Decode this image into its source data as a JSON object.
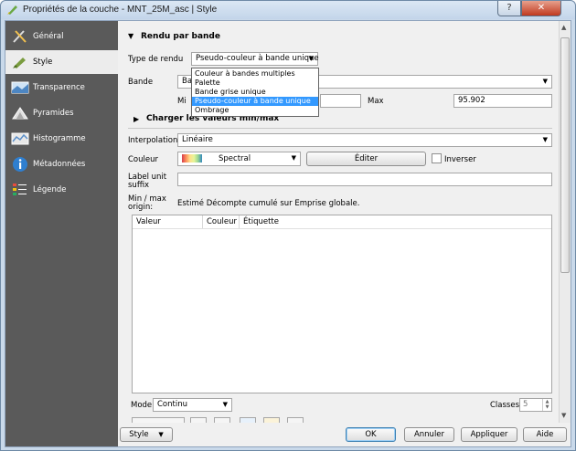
{
  "window": {
    "title": "Propriétés de la couche - MNT_25M_asc | Style",
    "help_glyph": "?",
    "close_glyph": "✕"
  },
  "sidebar": {
    "items": [
      {
        "label": "Général",
        "icon": "general-icon"
      },
      {
        "label": "Style",
        "icon": "style-icon",
        "active": true
      },
      {
        "label": "Transparence",
        "icon": "transparency-icon"
      },
      {
        "label": "Pyramides",
        "icon": "pyramids-icon"
      },
      {
        "label": "Histogramme",
        "icon": "histogram-icon"
      },
      {
        "label": "Métadonnées",
        "icon": "metadata-icon"
      },
      {
        "label": "Légende",
        "icon": "legend-icon"
      }
    ]
  },
  "render": {
    "group_title": "Rendu par bande",
    "type_label": "Type de rendu",
    "type_value": "Pseudo-couleur à bande unique",
    "band_label": "Bande",
    "band_value": "Ba",
    "min_label": "Mi",
    "max_label": "Max",
    "max_value": "95.902",
    "dropdown_options": [
      "Couleur à bandes multiples",
      "Palette",
      "Bande grise unique",
      "Pseudo-couleur à bande unique",
      "Ombrage"
    ]
  },
  "minmax": {
    "group_title": "Charger les valeurs min/max"
  },
  "interpolation": {
    "label": "Interpolation",
    "value": "Linéaire"
  },
  "color": {
    "label": "Couleur",
    "ramp_name": "Spectral",
    "edit_button": "Éditer",
    "invert_label": "Inverser"
  },
  "label_unit": {
    "label_line1": "Label unit",
    "label_line2": "suffix",
    "value": ""
  },
  "minmax_origin": {
    "label_line1": "Min / max",
    "label_line2": "origin:",
    "value": "Estimé Décompte cumulé sur Emprise globale."
  },
  "table": {
    "columns": [
      "Valeur",
      "Couleur",
      "Étiquette"
    ]
  },
  "mode": {
    "label": "Mode",
    "value": "Continu",
    "classes_label": "Classes",
    "classes_value": "5"
  },
  "footer": {
    "style_button": "Style",
    "ok_button": "OK",
    "cancel_button": "Annuler",
    "apply_button": "Appliquer",
    "help_button": "Aide"
  },
  "colors": {
    "sidebar_bg": "#5a5a5a",
    "selection": "#3399ff",
    "accent_border": "#3c7fb1"
  }
}
